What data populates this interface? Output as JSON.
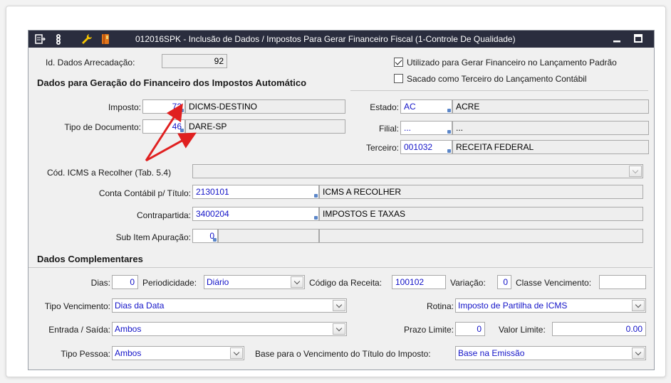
{
  "window": {
    "title": "012016SPK - Inclusão de Dados / Impostos  Para Gerar Financeiro Fiscal (1-Controle De Qualidade)"
  },
  "id_dados": {
    "label": "Id. Dados Arrecadação:",
    "value": "92"
  },
  "checkboxes": {
    "utilizado": {
      "label": "Utilizado para Gerar Financeiro no Lançamento Padrão",
      "checked": true
    },
    "sacado": {
      "label": "Sacado como Terceiro do Lançamento Contábil",
      "checked": false
    }
  },
  "section1": {
    "title": "Dados para Geração do Financeiro dos Impostos Automático"
  },
  "imposto": {
    "label": "Imposto:",
    "code": "72",
    "desc": "DICMS-DESTINO"
  },
  "tipo_documento": {
    "label": "Tipo de Documento:",
    "code": "46",
    "desc": "DARE-SP"
  },
  "estado": {
    "label": "Estado:",
    "code": "AC",
    "desc": "ACRE"
  },
  "filial": {
    "label": "Filial:",
    "code": "...",
    "desc": "..."
  },
  "terceiro": {
    "label": "Terceiro:",
    "code": "001032",
    "desc": "RECEITA FEDERAL"
  },
  "cod_icms": {
    "label": "Cód. ICMS a Recolher (Tab. 5.4)",
    "value": ""
  },
  "conta_contabil": {
    "label": "Conta Contábil p/ Título:",
    "code": "2130101",
    "desc": "ICMS A RECOLHER"
  },
  "contrapartida": {
    "label": "Contrapartida:",
    "code": "3400204",
    "desc": "IMPOSTOS E TAXAS"
  },
  "sub_item": {
    "label": "Sub Item Apuração:",
    "code": "0",
    "desc": ""
  },
  "section2": {
    "title": "Dados Complementares"
  },
  "dias": {
    "label": "Dias:",
    "value": "0"
  },
  "periodicidade": {
    "label": "Periodicidade:",
    "value": "Diário"
  },
  "codigo_receita": {
    "label": "Código da Receita:",
    "value": "100102"
  },
  "variacao": {
    "label": "Variação:",
    "value": "0"
  },
  "classe_vencimento": {
    "label": "Classe Vencimento:",
    "value": ""
  },
  "tipo_vencimento": {
    "label": "Tipo Vencimento:",
    "value": "Dias da Data"
  },
  "rotina": {
    "label": "Rotina:",
    "value": "Imposto de Partilha de ICMS"
  },
  "entrada_saida": {
    "label": "Entrada / Saída:",
    "value": "Ambos"
  },
  "prazo_limite": {
    "label": "Prazo Limite:",
    "value": "0"
  },
  "valor_limite": {
    "label": "Valor Limite:",
    "value": "0.00"
  },
  "tipo_pessoa": {
    "label": "Tipo Pessoa:",
    "value": "Ambos"
  },
  "base_vencimento": {
    "label": "Base para o Vencimento do Título do Imposto:",
    "value": "Base na Emissão"
  },
  "colors": {
    "titlebar": "#2a2d3e",
    "value_text": "#1313c8",
    "annotation_arrow": "#e02020"
  }
}
